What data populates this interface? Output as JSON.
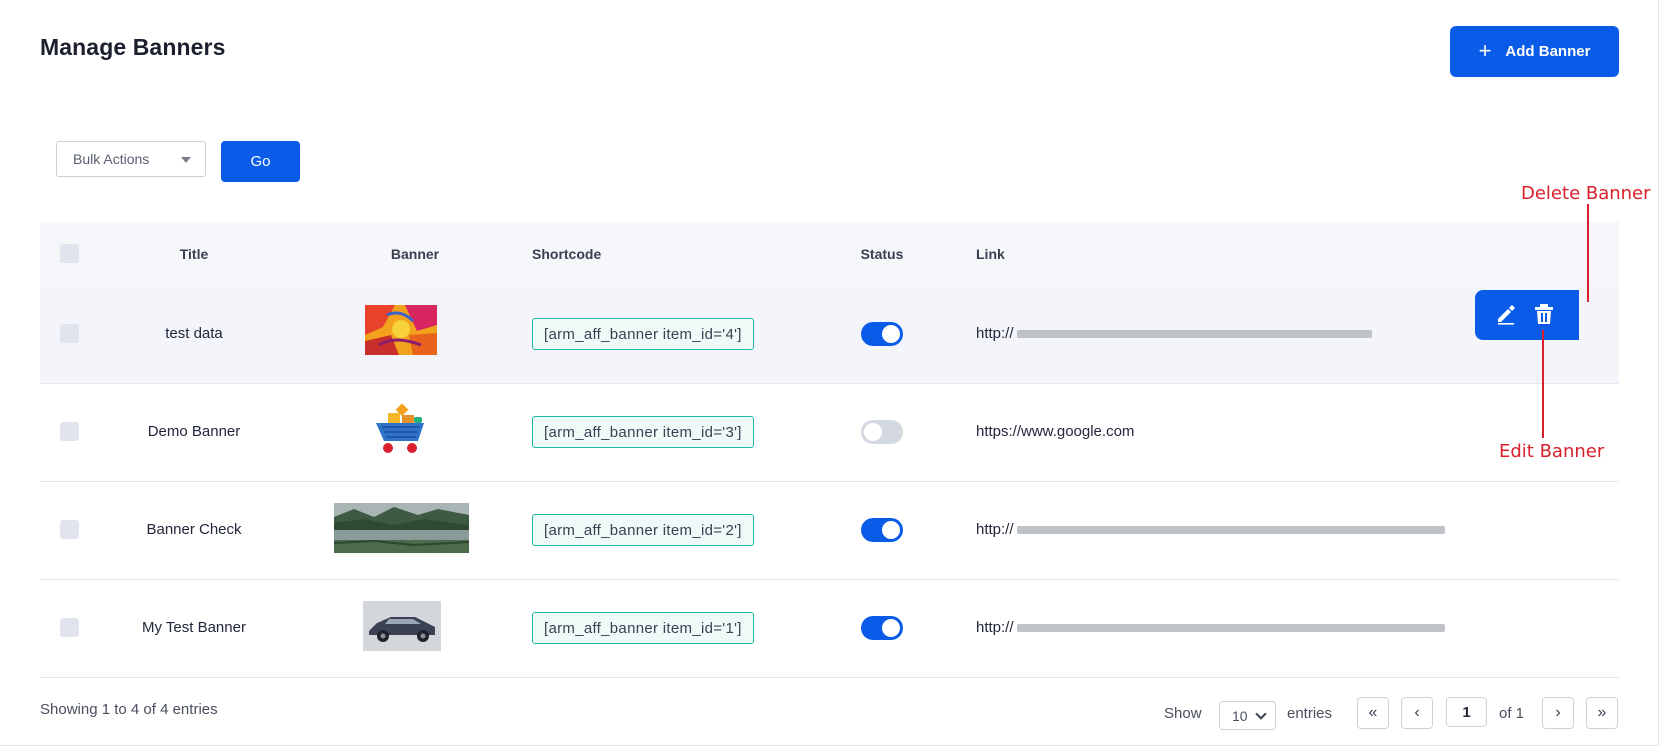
{
  "page": {
    "title": "Manage Banners"
  },
  "toolbar": {
    "add_label": "Add Banner",
    "add_icon": "plus-icon",
    "bulk_label": "Bulk Actions",
    "go_label": "Go"
  },
  "table": {
    "headers": {
      "title": "Title",
      "banner": "Banner",
      "shortcode": "Shortcode",
      "status": "Status",
      "link": "Link"
    },
    "rows": [
      {
        "title": "test data",
        "shortcode": "[arm_aff_banner item_id='4']",
        "status": "on",
        "link_prefix": "http://",
        "link_hidden": true,
        "thumb": "abstract-painting"
      },
      {
        "title": "Demo Banner",
        "shortcode": "[arm_aff_banner item_id='3']",
        "status": "off",
        "link": "https://www.google.com",
        "link_hidden": false,
        "thumb": "shopping-cart"
      },
      {
        "title": "Banner Check",
        "shortcode": "[arm_aff_banner item_id='2']",
        "status": "on",
        "link_prefix": "http://",
        "link_hidden": true,
        "thumb": "landscape-lake"
      },
      {
        "title": "My Test Banner",
        "shortcode": "[arm_aff_banner item_id='1']",
        "status": "on",
        "link_prefix": "http://",
        "link_hidden": true,
        "thumb": "car"
      }
    ]
  },
  "row_actions": {
    "edit_icon": "pencil-icon",
    "delete_icon": "trash-icon"
  },
  "annotations": {
    "delete": "Delete Banner",
    "edit": "Edit Banner",
    "color": "#d9202c"
  },
  "footer": {
    "info": "Showing 1 to 4 of 4 entries",
    "show_label": "Show",
    "page_size": "10",
    "entries_label": "entries",
    "first": "«",
    "prev": "‹",
    "current_page": "1",
    "of_label": "of 1",
    "next": "›",
    "last": "»"
  },
  "colors": {
    "primary": "#0a5ce8",
    "shortcode_border": "#1fb7a5",
    "header_bg": "#f5f7fb"
  }
}
